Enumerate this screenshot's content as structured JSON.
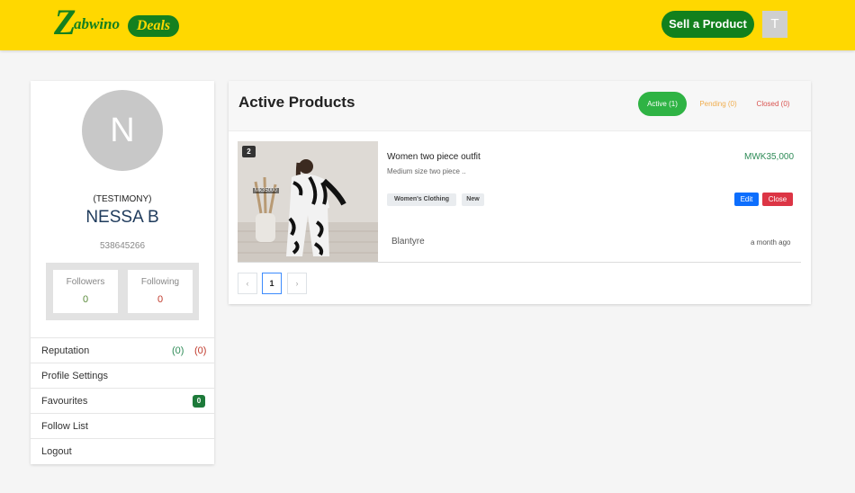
{
  "header": {
    "logo_letter": "Z",
    "logo_word": "abwino",
    "logo_badge": "Deals",
    "sell_button": "Sell a Product",
    "user_initial": "T"
  },
  "profile": {
    "avatar_initial": "N",
    "tag": "(TESTIMONY)",
    "name": "NESSA B",
    "id": "538645266",
    "followers_label": "Followers",
    "followers_count": "0",
    "following_label": "Following",
    "following_count": "0"
  },
  "menu": {
    "reputation": "Reputation",
    "reputation_pos": "(0)",
    "reputation_neg": "(0)",
    "profile_settings": "Profile Settings",
    "favourites": "Favourites",
    "favourites_count": "0",
    "follow_list": "Follow List",
    "logout": "Logout"
  },
  "products": {
    "title": "Active Products",
    "tabs": {
      "active": "Active (1)",
      "pending": "Pending (0)",
      "closed": "Closed (0)"
    },
    "items": [
      {
        "image_count": "2",
        "image_price": "Mk35000",
        "title": "Women two piece outfit",
        "description": "Medium size two piece ..",
        "price": "MWK35,000",
        "tags": [
          "Women's Clothing",
          "New"
        ],
        "edit_label": "Edit",
        "close_label": "Close",
        "location": "Blantyre",
        "posted": "a month ago"
      }
    ],
    "pagination": {
      "prev": "‹",
      "current": "1",
      "next": "›"
    }
  },
  "colors": {
    "header_bg": "#ffd800",
    "brand_green": "#12801d",
    "active_tab": "#2fb344",
    "edit": "#0d6efd",
    "close": "#dc3545"
  }
}
